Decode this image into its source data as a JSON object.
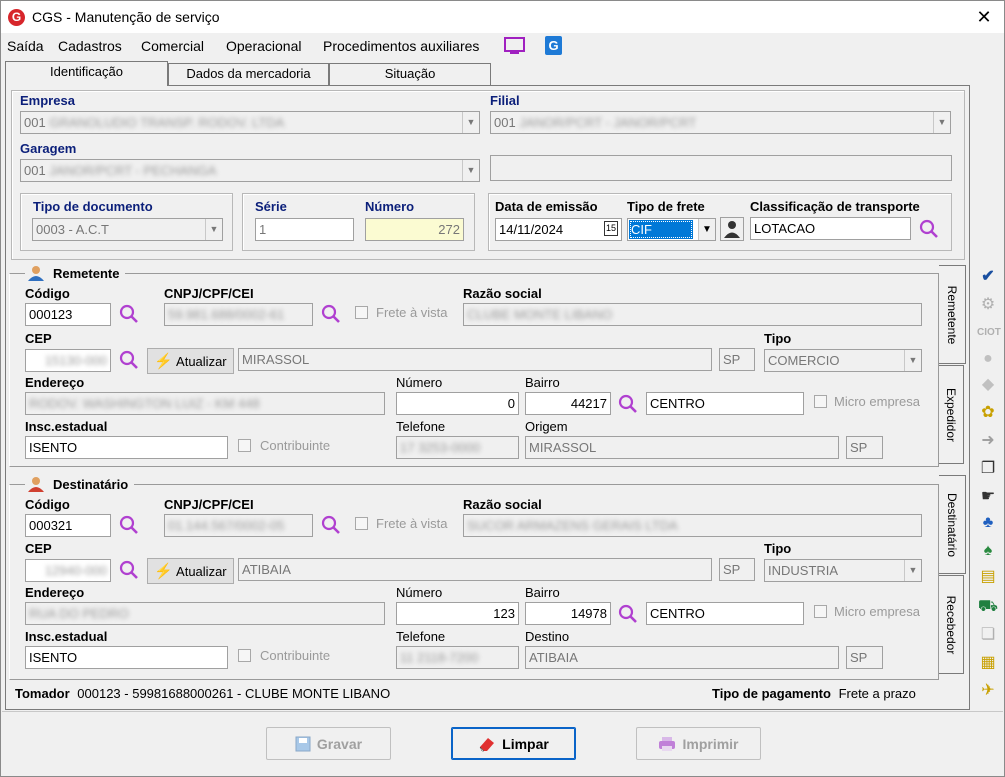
{
  "window": {
    "title": "CGS - Manutenção de serviço",
    "close": "✕"
  },
  "menu": [
    "Saída",
    "Cadastros",
    "Comercial",
    "Operacional",
    "Procedimentos auxiliares"
  ],
  "tabs": [
    "Identificação",
    "Dados da mercadoria",
    "Situação"
  ],
  "empresa": {
    "label": "Empresa",
    "value": "001",
    "blurred": "GRANOLUDIO TRANSP. RODOV. LTDA"
  },
  "filial": {
    "label": "Filial",
    "value": "001",
    "blurred": "JANOR/PCRT - JANOR/PCRT"
  },
  "garagem": {
    "label": "Garagem",
    "value": "001",
    "blurred": "JANOR/PCRT - PECHANGA"
  },
  "tipo_documento": {
    "label": "Tipo de documento",
    "value": "0003 - A.C.T"
  },
  "serie": {
    "label": "Série",
    "value": "1"
  },
  "numero": {
    "label": "Número",
    "value": "272"
  },
  "data_emissao": {
    "label": "Data de emissão",
    "value": "14/11/2024",
    "cal": "15"
  },
  "tipo_frete": {
    "label": "Tipo de frete",
    "value": "CIF"
  },
  "classificacao": {
    "label": "Classificação de transporte",
    "value": "LOTACAO"
  },
  "remetente": {
    "title": "Remetente",
    "codigo_label": "Código",
    "codigo": "000123",
    "cnpj_label": "CNPJ/CPF/CEI",
    "cnpj": "59.981.688/0002-61",
    "frete_vista": "Frete à vista",
    "razao_label": "Razão social",
    "razao": "CLUBE MONTE LIBANO",
    "cep_label": "CEP",
    "cep": "15130-000",
    "atualizar": "Atualizar",
    "cidade": "MIRASSOL",
    "uf": "SP",
    "tipo_label": "Tipo",
    "tipo": "COMERCIO",
    "endereco_label": "Endereço",
    "endereco": "RODOV. WASHINGTON LUIZ - KM 448",
    "numero_label": "Número",
    "numero": "0",
    "bairro_label": "Bairro",
    "bairro_cod": "44217",
    "bairro": "CENTRO",
    "micro": "Micro empresa",
    "insc_label": "Insc.estadual",
    "insc": "ISENTO",
    "contribuinte": "Contribuinte",
    "telefone_label": "Telefone",
    "telefone": "17 3253-0000",
    "origem_label": "Origem",
    "origem": "MIRASSOL",
    "origem_uf": "SP"
  },
  "destinatario": {
    "title": "Destinatário",
    "codigo_label": "Código",
    "codigo": "000321",
    "cnpj_label": "CNPJ/CPF/CEI",
    "cnpj": "01.144.567/0002-05",
    "frete_vista": "Frete à vista",
    "razao_label": "Razão social",
    "razao": "SUCOR ARMAZENS GERAIS LTDA",
    "cep_label": "CEP",
    "cep": "12940-000",
    "atualizar": "Atualizar",
    "cidade": "ATIBAIA",
    "uf": "SP",
    "tipo_label": "Tipo",
    "tipo": "INDUSTRIA",
    "endereco_label": "Endereço",
    "endereco": "RUA DO PEDRO",
    "numero_label": "Número",
    "numero": "123",
    "bairro_label": "Bairro",
    "bairro_cod": "14978",
    "bairro": "CENTRO",
    "micro": "Micro empresa",
    "insc_label": "Insc.estadual",
    "insc": "ISENTO",
    "contribuinte": "Contribuinte",
    "telefone_label": "Telefone",
    "telefone": "11 2118-7200",
    "destino_label": "Destino",
    "destino": "ATIBAIA",
    "destino_uf": "SP"
  },
  "side_tabs": [
    "Remetente",
    "Expedidor",
    "Destinatário",
    "Recebedor"
  ],
  "tomador": {
    "label": "Tomador",
    "value": "000123 - 59981688000261 - CLUBE MONTE LIBANO"
  },
  "pagamento": {
    "label": "Tipo de pagamento",
    "value": "Frete a prazo"
  },
  "buttons": {
    "gravar": "Gravar",
    "limpar": "Limpar",
    "imprimir": "Imprimir"
  },
  "colors": {
    "label_blue": "#0b1f7a",
    "accent_purple": "#b040d0",
    "brand_red": "#d7262b"
  }
}
